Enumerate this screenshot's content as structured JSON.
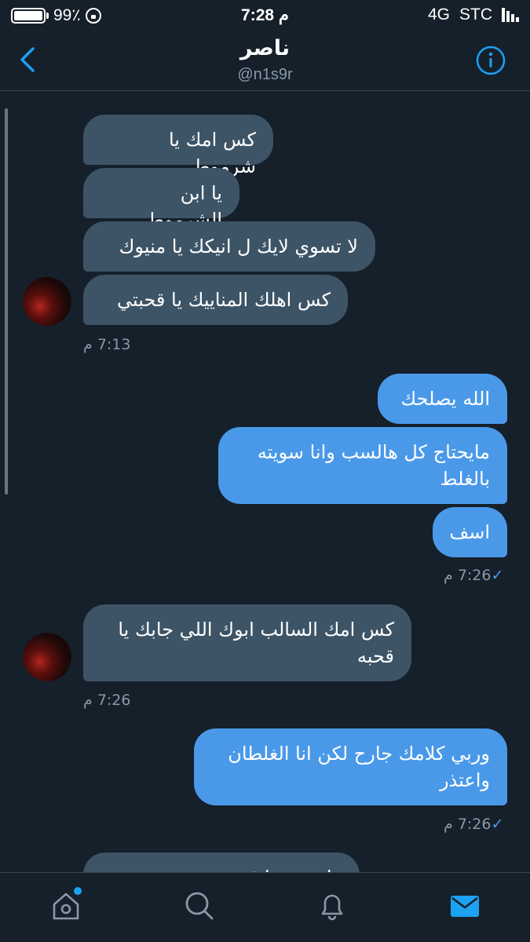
{
  "status_bar": {
    "battery": "99٪",
    "time": "7:28 م",
    "network": "4G",
    "carrier": "STC"
  },
  "header": {
    "name": "ناصر",
    "handle": "@n1s9r"
  },
  "messages": {
    "m1": "كس امك يا شرموط",
    "m2": "يا ابن الشرموط",
    "m3": "لا تسوي لايك ل انيكك يا منيوك",
    "m4": "كس اهلك المناييك يا قحبتي",
    "t1": "7:13 م",
    "m5": "الله يصلحك",
    "m6": "مايحتاج كل هالسب وانا سويته بالغلط",
    "m7": "اسف",
    "t2": "7:26 م",
    "m8": "كس امك السالب ابوك اللي جابك يا قحبه",
    "t3": "7:26 م",
    "m9": "وربي كلامك جارح لكن انا الغلطان واعتذر",
    "t4": "7:26 م",
    "m10": "ما تعتذر يا قحبه"
  },
  "colors": {
    "background": "#15202b",
    "incoming": "#3d5466",
    "outgoing": "#4a99e9",
    "accent": "#1da1f2"
  }
}
